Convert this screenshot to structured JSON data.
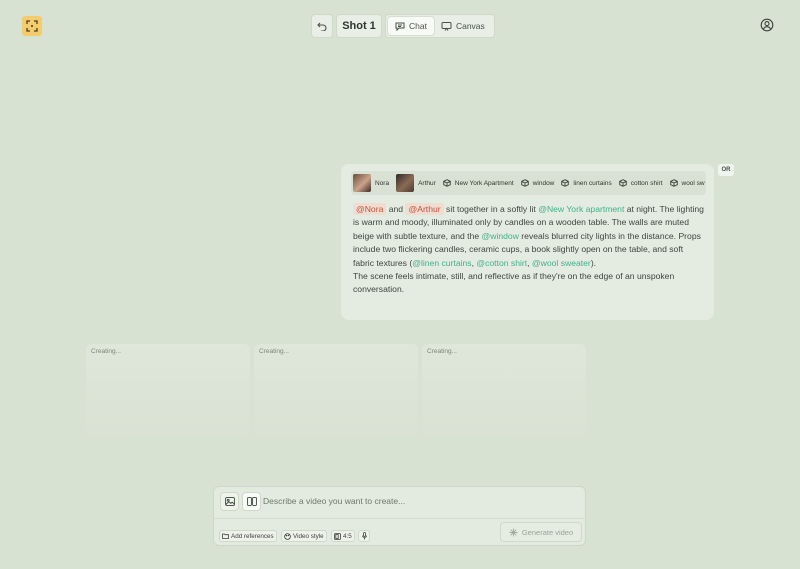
{
  "header": {
    "shot_label": "Shot 1",
    "tabs": [
      {
        "label": "Chat",
        "active": true
      },
      {
        "label": "Canvas",
        "active": false
      }
    ]
  },
  "prompt": {
    "or_badge": "OR",
    "chips": [
      {
        "type": "person",
        "label": "Nora"
      },
      {
        "type": "person",
        "label": "Arthur"
      },
      {
        "type": "object",
        "label": "New York Apartment"
      },
      {
        "type": "object",
        "label": "window"
      },
      {
        "type": "object",
        "label": "linen curtains"
      },
      {
        "type": "object",
        "label": "cotton shirt"
      },
      {
        "type": "object",
        "label": "wool sw"
      }
    ],
    "text": {
      "m_nora": "@Nora",
      "and": "and",
      "m_arthur": "@Arthur",
      "p1": "sit together in a softly lit",
      "m_apartment": "@New York apartment",
      "p2": "at night. The lighting is warm and moody, illuminated only by candles on a wooden table. The walls are muted beige with subtle texture, and the",
      "m_window": "@window",
      "p3": "reveals blurred city lights in the distance. Props include two flickering candles, ceramic cups, a book slightly open on the table, and soft fabric textures (",
      "m_linen": "@linen curtains",
      "comma1": ",",
      "m_cotton": "@cotton shirt",
      "comma2": ",",
      "m_wool": "@wool sweater",
      "p4": ").",
      "p5": "The scene feels intimate, still, and reflective as if they're on the edge of an unspoken conversation."
    }
  },
  "results": [
    {
      "status": "Creating..."
    },
    {
      "status": "Creating..."
    },
    {
      "status": "Creating..."
    }
  ],
  "composer": {
    "placeholder": "Describe a video you want to create...",
    "add_references": "Add references",
    "video_style": "Video style",
    "aspect_ratio": "4:5",
    "generate_label": "Generate video"
  },
  "colors": {
    "background": "#d8e2d2",
    "logo": "#f3cc6e",
    "person_mention": "#c2543a",
    "object_mention": "#3fb28c"
  }
}
